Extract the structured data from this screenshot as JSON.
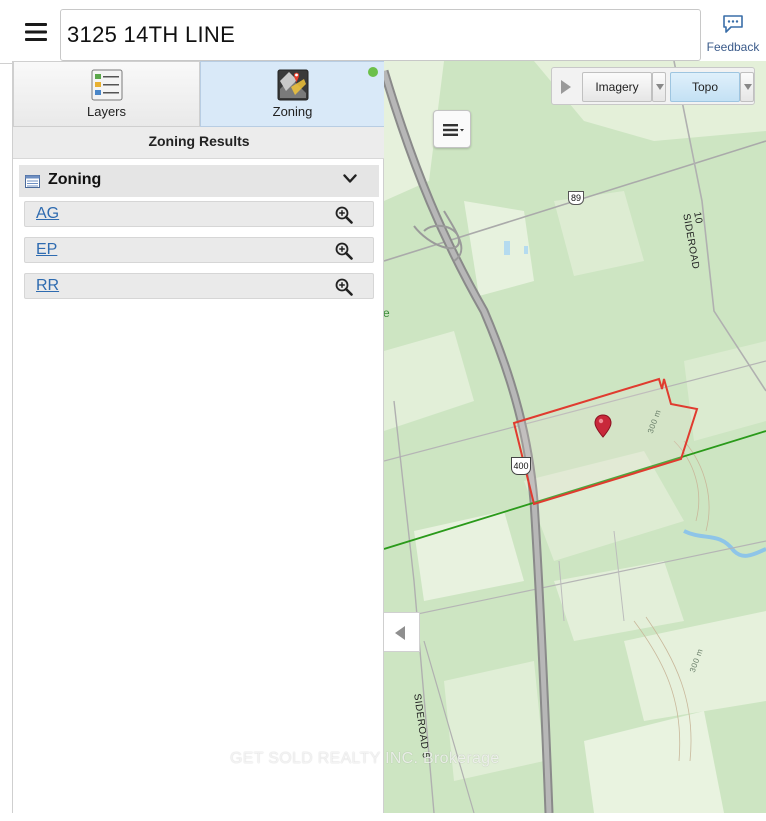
{
  "search": {
    "value": "3125 14TH LINE"
  },
  "feedback": {
    "label": "Feedback"
  },
  "tabs": [
    {
      "label": "Layers"
    },
    {
      "label": "Zoning"
    }
  ],
  "results_header": "Zoning Results",
  "zoning_group": {
    "title": "Zoning",
    "items": [
      {
        "label": "AG"
      },
      {
        "label": "EP"
      },
      {
        "label": "RR"
      }
    ]
  },
  "basemap": {
    "options": [
      {
        "label": "Imagery"
      },
      {
        "label": "Topo"
      }
    ],
    "selected": "Topo"
  },
  "map": {
    "road_labels": [
      "10 SIDEROAD",
      "SIDEROAD 5"
    ],
    "contour_labels": [
      "300 m",
      "300 m"
    ],
    "edge_label": "e",
    "highway_shields": [
      "89",
      "400"
    ],
    "property_outline_color": "#e03b2f",
    "boundary_line_color": "#2a9a1a"
  },
  "watermark": "GET SOLD REALTY INC. Brokerage"
}
